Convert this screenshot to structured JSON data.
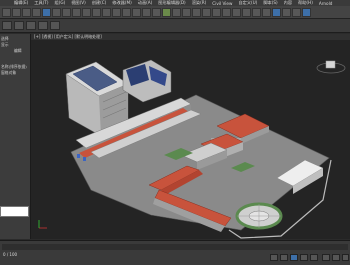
{
  "menu": {
    "items": [
      "编辑(E)",
      "工具(T)",
      "组(G)",
      "视图(V)",
      "创建(C)",
      "修改器(M)",
      "动画(A)",
      "图形编辑器(D)",
      "渲染(R)",
      "Civil View",
      "自定义(U)",
      "脚本(S)",
      "内容",
      "帮助(H)",
      "Arnold"
    ]
  },
  "toolbar": {
    "selection_filter": "全部"
  },
  "left_panel": {
    "items": [
      "选择",
      "显示",
      "编辑",
      "名称(排序依据)",
      "窗格对象"
    ]
  },
  "viewport": {
    "label": "[+] [透视] [用户定义] [默认明暗处理]"
  },
  "timeline": {
    "frame_label": "0 / 100"
  },
  "colors": {
    "roof_red": "#c8533c",
    "roof_white": "#d8d8d8",
    "ground": "#8a8a8a",
    "glass": "#4a5c86"
  }
}
